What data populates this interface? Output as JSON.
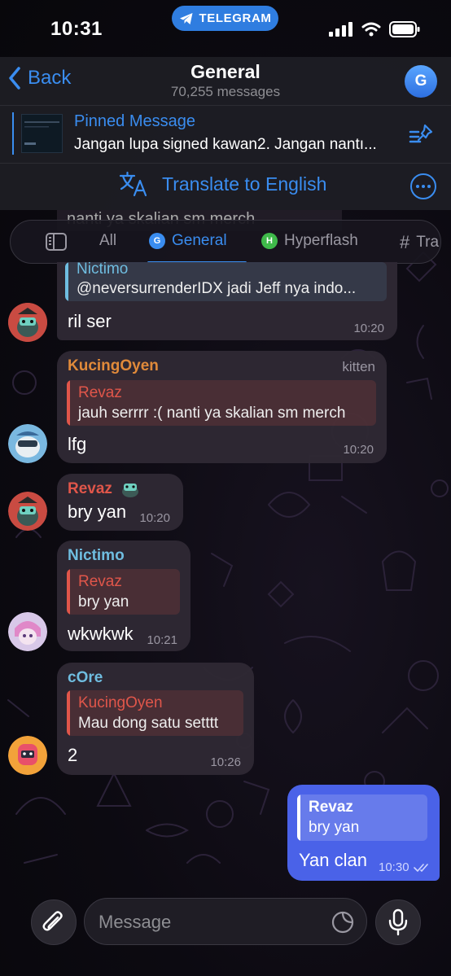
{
  "status_bar": {
    "time": "10:31",
    "app_pill": "TELEGRAM"
  },
  "header": {
    "back_label": "Back",
    "title": "General",
    "subtitle": "70,255 messages",
    "avatar_letter": "G"
  },
  "pinned": {
    "label": "Pinned Message",
    "text": "Jangan lupa signed kawan2. Jangan nantı..."
  },
  "translate": {
    "label": "Translate to English"
  },
  "behind_text": "nanti ya skalian sm merch",
  "tabs": [
    {
      "label": "All",
      "icon": "sidebar-icon"
    },
    {
      "label": "General",
      "icon": "G",
      "color": "#3a8df0"
    },
    {
      "label": "Hyperflash",
      "icon": "H",
      "color": "#3fba4a"
    },
    {
      "label": "Tra",
      "icon": "hash-icon"
    }
  ],
  "messages": [
    {
      "reply_name": "Nictimo",
      "reply_text": "@neversurrenderIDX jadi Jeff nya indo...",
      "text": "ril ser",
      "time": "10:20"
    },
    {
      "sender": "KucingOyen",
      "sender_tag": "kitten",
      "reply_name": "Revaz",
      "reply_text": "jauh serrrr :( nanti ya skalian sm merch",
      "text": "lfg",
      "time": "10:20"
    },
    {
      "sender": "Revaz",
      "text": "bry yan",
      "time": "10:20"
    },
    {
      "sender": "Nictimo",
      "reply_name": "Revaz",
      "reply_text": "bry yan",
      "text": "wkwkwk",
      "time": "10:21"
    },
    {
      "sender": "cOre",
      "reply_name": "KucingOyen",
      "reply_text": "Mau dong satu setttt",
      "text": "2",
      "time": "10:26"
    },
    {
      "reply_name": "Revaz",
      "reply_text": "bry yan",
      "text": "Yan clan",
      "time": "10:30"
    }
  ],
  "input": {
    "placeholder": "Message"
  },
  "colors": {
    "accent": "#3a8df0",
    "outgoing_bubble": "#4a62e8",
    "incoming_bubble": "#2e2834",
    "name_red": "#e0564a",
    "name_blue": "#6fbde0",
    "name_orange": "#e08a3a"
  }
}
